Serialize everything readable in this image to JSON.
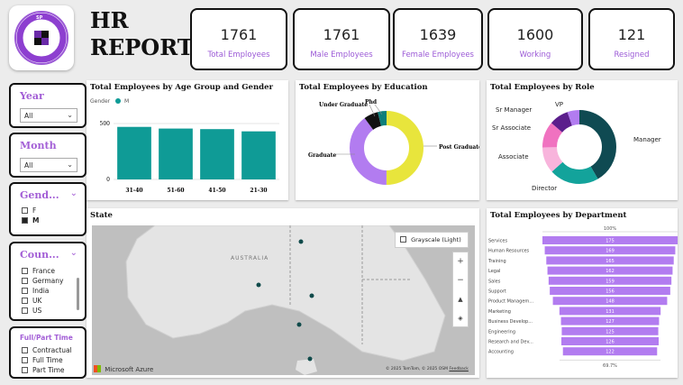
{
  "header": {
    "logo_text": "SP",
    "logo_motto": "WE EMPOWER THE BEST IT SOLUTIONS",
    "title_line1": "HR",
    "title_line2": "REPORT"
  },
  "kpis": [
    {
      "value": "1761",
      "label": "Total Employees"
    },
    {
      "value": "1761",
      "label": "Male Employees"
    },
    {
      "value": "1639",
      "label": "Female Employees"
    },
    {
      "value": "1600",
      "label": "Working"
    },
    {
      "value": "121",
      "label": "Resigned"
    }
  ],
  "slicers": {
    "year": {
      "title": "Year",
      "value": "All"
    },
    "month": {
      "title": "Month",
      "value": "All"
    },
    "gender": {
      "title": "Gend...",
      "options": [
        {
          "label": "F",
          "checked": false
        },
        {
          "label": "M",
          "checked": true
        }
      ]
    },
    "country": {
      "title": "Coun...",
      "options": [
        {
          "label": "France"
        },
        {
          "label": "Germany"
        },
        {
          "label": "India"
        },
        {
          "label": "UK"
        },
        {
          "label": "US"
        }
      ]
    },
    "employment": {
      "title": "Full/Part Time",
      "options": [
        {
          "label": "Contractual"
        },
        {
          "label": "Full Time"
        },
        {
          "label": "Part Time"
        }
      ]
    }
  },
  "age_chart": {
    "title": "Total Employees by Age Group and Gender",
    "legend_title": "Gender",
    "legend_item": "M",
    "color": "#0f9b96"
  },
  "education_chart": {
    "title": "Total Employees by Education",
    "colors": {
      "post_graduate": "#e8e53c",
      "graduate": "#b27cf0",
      "under_graduate": "#111111",
      "phd": "#0f7f7a"
    }
  },
  "role_chart": {
    "title": "Total Employees by Role",
    "colors": {
      "manager": "#0f4a52",
      "director": "#13a39b",
      "associate": "#f8b4dc",
      "sr_associate": "#f072c0",
      "sr_manager": "#5b1e8c",
      "vp": "#b27cf0"
    }
  },
  "dept_chart": {
    "title": "Total Employees by Department",
    "top_pct": "100%",
    "bottom_pct": "69.7%",
    "color": "#b27cf0"
  },
  "map": {
    "title": "State",
    "style_label": "Grayscale (Light)",
    "region_label": "AUSTRALIA",
    "attribution": "Microsoft Azure",
    "copyright": "© 2025 TomTom, © 2025 OSM",
    "feedback": "Feedback"
  },
  "chart_data": [
    {
      "type": "bar",
      "title": "Total Employees by Age Group and Gender",
      "categories": [
        "31-40",
        "51-60",
        "41-50",
        "21-30"
      ],
      "series": [
        {
          "name": "M",
          "values": [
            470,
            455,
            450,
            430
          ]
        }
      ],
      "ylim": [
        0,
        500
      ],
      "yticks": [
        0,
        500
      ],
      "legend": "top-left"
    },
    {
      "type": "pie",
      "title": "Total Employees by Education",
      "categories": [
        "Post Graduate",
        "Graduate",
        "Under Graduate",
        "Phd"
      ],
      "values": [
        880,
        700,
        110,
        71
      ],
      "donut": true
    },
    {
      "type": "pie",
      "title": "Total Employees by Role",
      "categories": [
        "Manager",
        "Director",
        "Associate",
        "Sr Associate",
        "Sr Manager",
        "VP"
      ],
      "values": [
        690,
        360,
        190,
        190,
        140,
        90
      ],
      "donut": true
    },
    {
      "type": "bar",
      "title": "Total Employees by Department",
      "categories": [
        "Services",
        "Human Resources",
        "Training",
        "Legal",
        "Sales",
        "Support",
        "Product Managem...",
        "Marketing",
        "Business Develop...",
        "Engineering",
        "Research and Dev...",
        "Accounting"
      ],
      "values": [
        175,
        169,
        165,
        162,
        159,
        156,
        148,
        131,
        127,
        125,
        126,
        122
      ],
      "orientation": "horizontal-funnel"
    }
  ]
}
